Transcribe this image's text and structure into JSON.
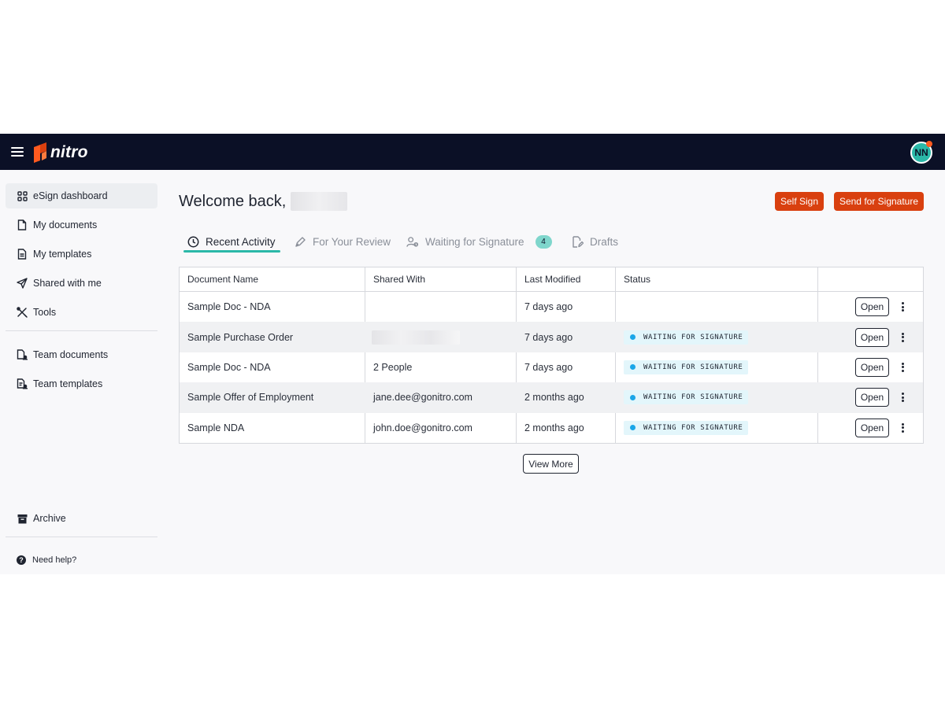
{
  "app": {
    "logo_text": "nitro",
    "user_initials": "NN",
    "brand_color": "#d9400f",
    "accent_color": "#2bb8a8",
    "header_bg": "#0b1026"
  },
  "sidebar": {
    "items": [
      {
        "label": "eSign dashboard",
        "icon": "grid-icon",
        "active": true
      },
      {
        "label": "My documents",
        "icon": "document-icon"
      },
      {
        "label": "My templates",
        "icon": "template-icon"
      },
      {
        "label": "Shared with me",
        "icon": "send-icon"
      },
      {
        "label": "Tools",
        "icon": "tools-icon"
      },
      {
        "label": "Team documents",
        "icon": "team-document-icon"
      },
      {
        "label": "Team templates",
        "icon": "team-template-icon"
      },
      {
        "label": "Archive",
        "icon": "archive-icon"
      }
    ],
    "help_label": "Need help?"
  },
  "main": {
    "welcome": "Welcome back,",
    "buttons": {
      "self_sign": "Self Sign",
      "send_for_signature": "Send for Signature"
    },
    "tabs": [
      {
        "label": "Recent Activity",
        "icon": "clock-icon",
        "active": true
      },
      {
        "label": "For Your Review",
        "icon": "pen-icon"
      },
      {
        "label": "Waiting for Signature",
        "icon": "user-clock-icon",
        "badge": "4"
      },
      {
        "label": "Drafts",
        "icon": "draft-icon"
      }
    ],
    "table": {
      "columns": [
        "Document Name",
        "Shared With",
        "Last Modified",
        "Status"
      ],
      "rows": [
        {
          "name": "Sample Doc - NDA",
          "shared_with": "",
          "modified": "7 days ago",
          "status": "",
          "action": "Open"
        },
        {
          "name": "Sample Purchase Order",
          "shared_with": "",
          "shared_redacted": true,
          "modified": "7 days ago",
          "status": "WAITING FOR SIGNATURE",
          "action": "Open"
        },
        {
          "name": "Sample Doc - NDA",
          "shared_with": "2 People",
          "modified": "7 days ago",
          "status": "WAITING FOR SIGNATURE",
          "action": "Open"
        },
        {
          "name": "Sample Offer of Employment",
          "shared_with": "jane.dee@gonitro.com",
          "modified": "2 months ago",
          "status": "WAITING FOR SIGNATURE",
          "action": "Open"
        },
        {
          "name": "Sample NDA",
          "shared_with": "john.doe@gonitro.com",
          "modified": "2 months ago",
          "status": "WAITING FOR SIGNATURE",
          "action": "Open"
        }
      ]
    },
    "view_more": "View More"
  }
}
